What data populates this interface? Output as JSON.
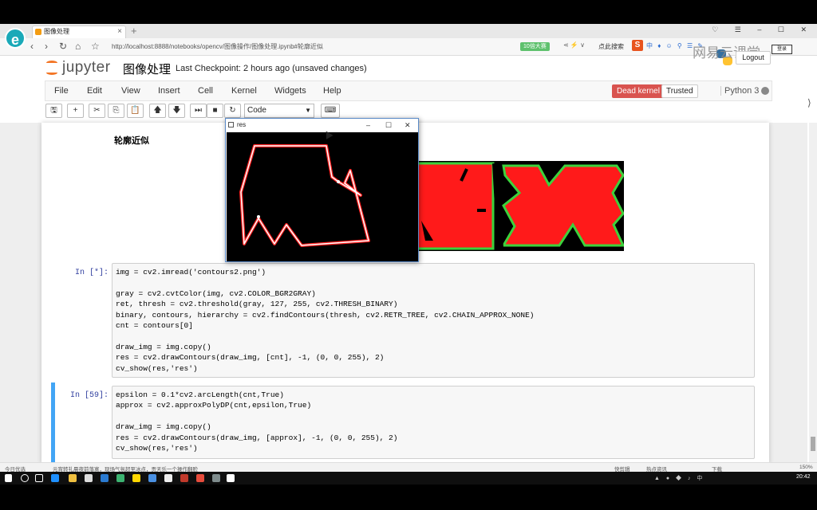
{
  "browser": {
    "logo": "e",
    "tab_title": "图像处理",
    "tab_close": "×",
    "new_tab": "+",
    "window_controls": "♡ ☰ – ☐ ✕",
    "url": "http://localhost:8888/notebooks/opencv/图像操作/图像处理.ipynb#轮廓近似",
    "speed_badge": "10倍大赛",
    "search_label": "点此搜索",
    "ext_label": "S",
    "ext_icons": "中 ♦ ☺ ⚲ ☰ ✎",
    "watermark": "网易云课堂"
  },
  "jupyter": {
    "brand": "jupyter",
    "notebook_name": "图像处理",
    "checkpoint": "Last Checkpoint: 2 hours ago (unsaved changes)",
    "logout": "Logout",
    "login_badge": "登录",
    "menus": [
      "File",
      "Edit",
      "View",
      "Insert",
      "Cell",
      "Kernel",
      "Widgets",
      "Help"
    ],
    "dead_kernel": "Dead kernel",
    "trusted": "Trusted",
    "kernel_name": "Python 3",
    "cell_type": "Code"
  },
  "toolbar": {
    "save": "🖫",
    "add": "+",
    "cut": "✂",
    "copy": "⎘",
    "paste": "📋",
    "up": "🡅",
    "down": "🡇",
    "run": "⏭",
    "stop": "■",
    "restart": "↻",
    "keyboard": "⌨"
  },
  "notebook": {
    "heading": "轮廓近似",
    "cells": [
      {
        "prompt": "In [*]:",
        "lines": [
          "img = cv2.imread('contours2.png')",
          "",
          "gray = cv2.cvtColor(img, cv2.COLOR_BGR2GRAY)",
          "ret, thresh = cv2.threshold(gray, 127, 255, cv2.THRESH_BINARY)",
          "binary, contours, hierarchy = cv2.findContours(thresh, cv2.RETR_TREE, cv2.CHAIN_APPROX_NONE)",
          "cnt = contours[0]",
          "",
          "draw_img = img.copy()",
          "res = cv2.drawContours(draw_img, [cnt], -1, (0, 0, 255), 2)",
          "cv_show(res,'res')"
        ]
      },
      {
        "prompt": "In [59]:",
        "lines": [
          "epsilon = 0.1*cv2.arcLength(cnt,True)",
          "approx = cv2.approxPolyDP(cnt,epsilon,True)",
          "",
          "draw_img = img.copy()",
          "res = cv2.drawContours(draw_img, [approx], -1, (0, 0, 255), 2)",
          "cv_show(res,'res')"
        ]
      }
    ]
  },
  "popup": {
    "title": "res",
    "min": "–",
    "max": "☐",
    "close": "✕"
  },
  "statusbar": {
    "left1": "今日优选",
    "left2": "元宵转礼晨夜前落寞，现场气氛超至冰点，贡天乐一个操作翻脸",
    "right1": "快剪辑",
    "right2": "热点资讯",
    "right3": "下载",
    "zoom": "150%"
  },
  "taskbar": {
    "time": "20:42",
    "tray": "▲ ● ◆ ♪ 中"
  },
  "colors": {
    "dead_kernel": "#d9534f",
    "jupyter_orange": "#f37626",
    "prompt_blue": "#303f9f",
    "selected_cell": "#42a5f5",
    "contour_red": "#ff2020",
    "shape_green": "#3cd23c"
  }
}
